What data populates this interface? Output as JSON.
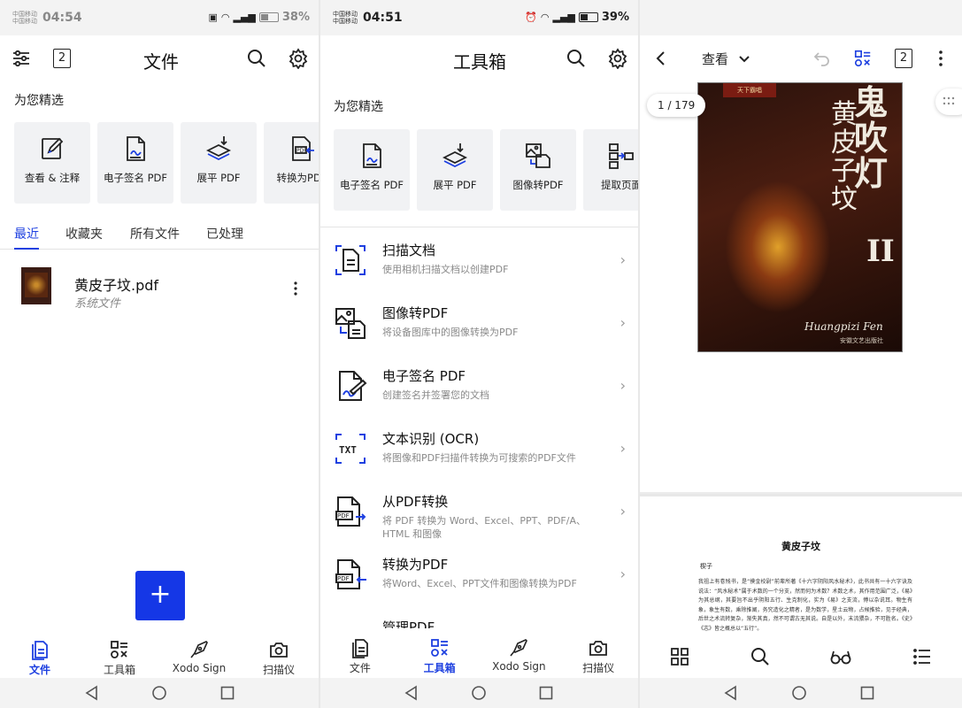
{
  "colors": {
    "accent": "#1e40e0",
    "fab": "#1537e6",
    "card_bg": "#f1f2f4"
  },
  "status_bars": [
    {
      "carrier": "中国移动\n中国移动",
      "time": "04:54",
      "battery": "38%"
    },
    {
      "carrier": "中国移动\n中国移动",
      "time": "04:51",
      "battery": "39%"
    },
    {
      "carrier": "",
      "time": "",
      "battery": ""
    }
  ],
  "screen1": {
    "header": {
      "title": "文件",
      "badge": "2"
    },
    "featured_title": "为您精选",
    "cards": [
      {
        "label": "查看 & 注释",
        "icon": "edit-document-icon"
      },
      {
        "label": "电子签名 PDF",
        "icon": "signature-icon"
      },
      {
        "label": "展平 PDF",
        "icon": "flatten-icon"
      },
      {
        "label": "转换为PDF",
        "icon": "convert-to-pdf-icon"
      }
    ],
    "tabs": [
      "最近",
      "收藏夹",
      "所有文件",
      "已处理"
    ],
    "active_tab": 0,
    "file": {
      "name": "黄皮子坟.pdf",
      "location": "系统文件"
    },
    "fab_label": "+"
  },
  "screen2": {
    "header": {
      "title": "工具箱"
    },
    "featured_title": "为您精选",
    "cards": [
      {
        "label": "电子签名 PDF",
        "icon": "signature-icon"
      },
      {
        "label": "展平 PDF",
        "icon": "flatten-icon"
      },
      {
        "label": "图像转PDF",
        "icon": "image-to-pdf-icon"
      },
      {
        "label": "提取页面",
        "icon": "extract-pages-icon"
      }
    ],
    "tools": [
      {
        "title": "扫描文档",
        "subtitle": "使用相机扫描文档以创建PDF",
        "icon": "scan-document-icon"
      },
      {
        "title": "图像转PDF",
        "subtitle": "将设备图库中的图像转换为PDF",
        "icon": "image-to-pdf-icon"
      },
      {
        "title": "电子签名 PDF",
        "subtitle": "创建签名并签署您的文档",
        "icon": "signature-icon"
      },
      {
        "title": "文本识别 (OCR)",
        "subtitle": "将图像和PDF扫描件转换为可搜索的PDF文件",
        "icon": "ocr-icon"
      },
      {
        "title": "从PDF转换",
        "subtitle": "将 PDF 转换为 Word、Excel、PPT、PDF/A、HTML 和图像",
        "icon": "convert-from-pdf-icon"
      },
      {
        "title": "转换为PDF",
        "subtitle": "将Word、Excel、PPT文件和图像转换为PDF",
        "icon": "convert-to-pdf-icon"
      },
      {
        "title": "管理PDF",
        "subtitle": "",
        "icon": "manage-pdf-icon"
      }
    ]
  },
  "bottom_nav": [
    "文件",
    "工具箱",
    "Xodo Sign",
    "扫描仪"
  ],
  "screen3": {
    "header": {
      "view_label": "查看",
      "badge": "2"
    },
    "page_counter": "1 / 179",
    "book_cover": {
      "title": "鬼吹灯",
      "subtitle": "黄皮子坟",
      "volume": "II",
      "pinyin": "Huangpizi Fen",
      "brand": "天下霸唱",
      "publisher": "安徽文艺出版社"
    },
    "page2": {
      "title": "黄皮子坟",
      "author": "楔子",
      "body": "我祖上有卷残书，是“摸金校尉”前辈所著《十六字阴阳风水秘术》，此书共有一十六字诀及说法：“风水秘术”属于术数的一个分支，然而何为术数？术数之术，其作用范围广泛，《易》为其总纲，其要旨不出乎阴阳五行、生克制化，实为《易》之支流，傅以杂说耳。物生有象，象生有数，乘除推阐，务究造化之精者，是为数学，星土云物，占候推验，见于经典，后世之术流转复杂，渐失其真，然不可谓古无其说。自是以外，末流猥杂，不可胜名。《史》《志》皆之概总以“五行”。"
    }
  }
}
